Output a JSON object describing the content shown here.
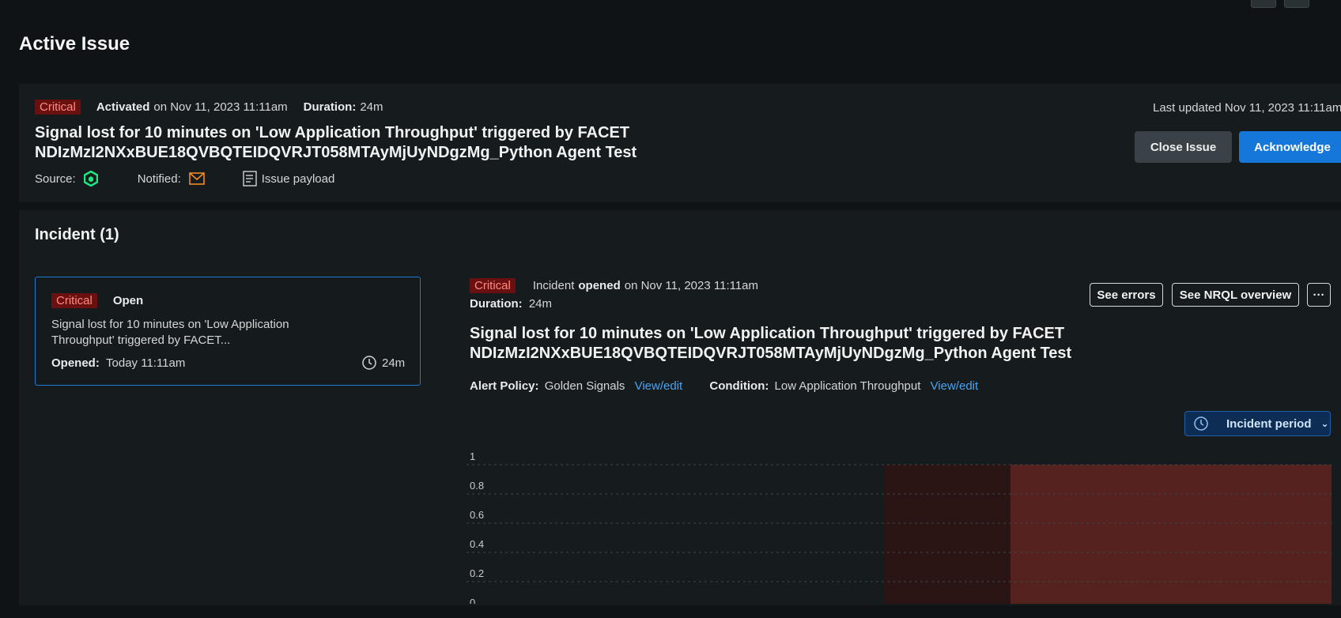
{
  "page": {
    "title": "Active Issue"
  },
  "issue": {
    "severity": "Critical",
    "activated_label": "Activated",
    "activated_value": "on Nov 11, 2023 11:11am",
    "duration_label": "Duration:",
    "duration_value": "24m",
    "last_updated": "Last updated Nov 11, 2023 11:11am",
    "title_line1": "Signal lost for 10 minutes on 'Low Application Throughput' triggered by FACET",
    "title_line2": "NDIzMzI2NXxBUE18QVBQTEIDQVRJT058MTAyMjUyNDgzMg_Python Agent Test",
    "source_label": "Source:",
    "notified_label": "Notified:",
    "payload_label": "Issue payload",
    "close_button": "Close Issue",
    "ack_button": "Acknowledge"
  },
  "incidents": {
    "heading": "Incident (1)",
    "item": {
      "severity": "Critical",
      "status": "Open",
      "desc_line1": "Signal lost for 10 minutes on 'Low Application",
      "desc_line2": "Throughput' triggered by FACET...",
      "opened_label": "Opened:",
      "opened_value": "Today 11:11am",
      "duration": "24m"
    },
    "detail": {
      "severity": "Critical",
      "opened_prefix": "Incident",
      "opened_word": "opened",
      "opened_suffix": "on Nov 11, 2023 11:11am",
      "duration_label": "Duration:",
      "duration_value": "24m",
      "title_line1": "Signal lost for 10 minutes on 'Low Application Throughput' triggered by FACET",
      "title_line2": "NDIzMzI2NXxBUE18QVBQTEIDQVRJT058MTAyMjUyNDgzMg_Python Agent Test",
      "policy_label": "Alert Policy:",
      "policy_value": "Golden Signals",
      "policy_link": "View/edit",
      "condition_label": "Condition:",
      "condition_value": "Low Application Throughput",
      "condition_link": "View/edit",
      "see_errors": "See errors",
      "see_nrql": "See NRQL overview",
      "more": "···",
      "period_button": "Incident period"
    }
  },
  "colors": {
    "critical_bg": "#6b1010",
    "critical_text": "#ff8a80",
    "primary": "#1477d9",
    "link": "#4aa3f0",
    "period_shade_light": "#2a1414",
    "period_shade_strong": "#552220"
  },
  "chart_data": {
    "type": "area",
    "y_ticks": [
      "1",
      "0.8",
      "0.6",
      "0.4",
      "0.2",
      "0"
    ],
    "ylim": [
      0,
      1
    ],
    "grid": true,
    "series": []
  }
}
